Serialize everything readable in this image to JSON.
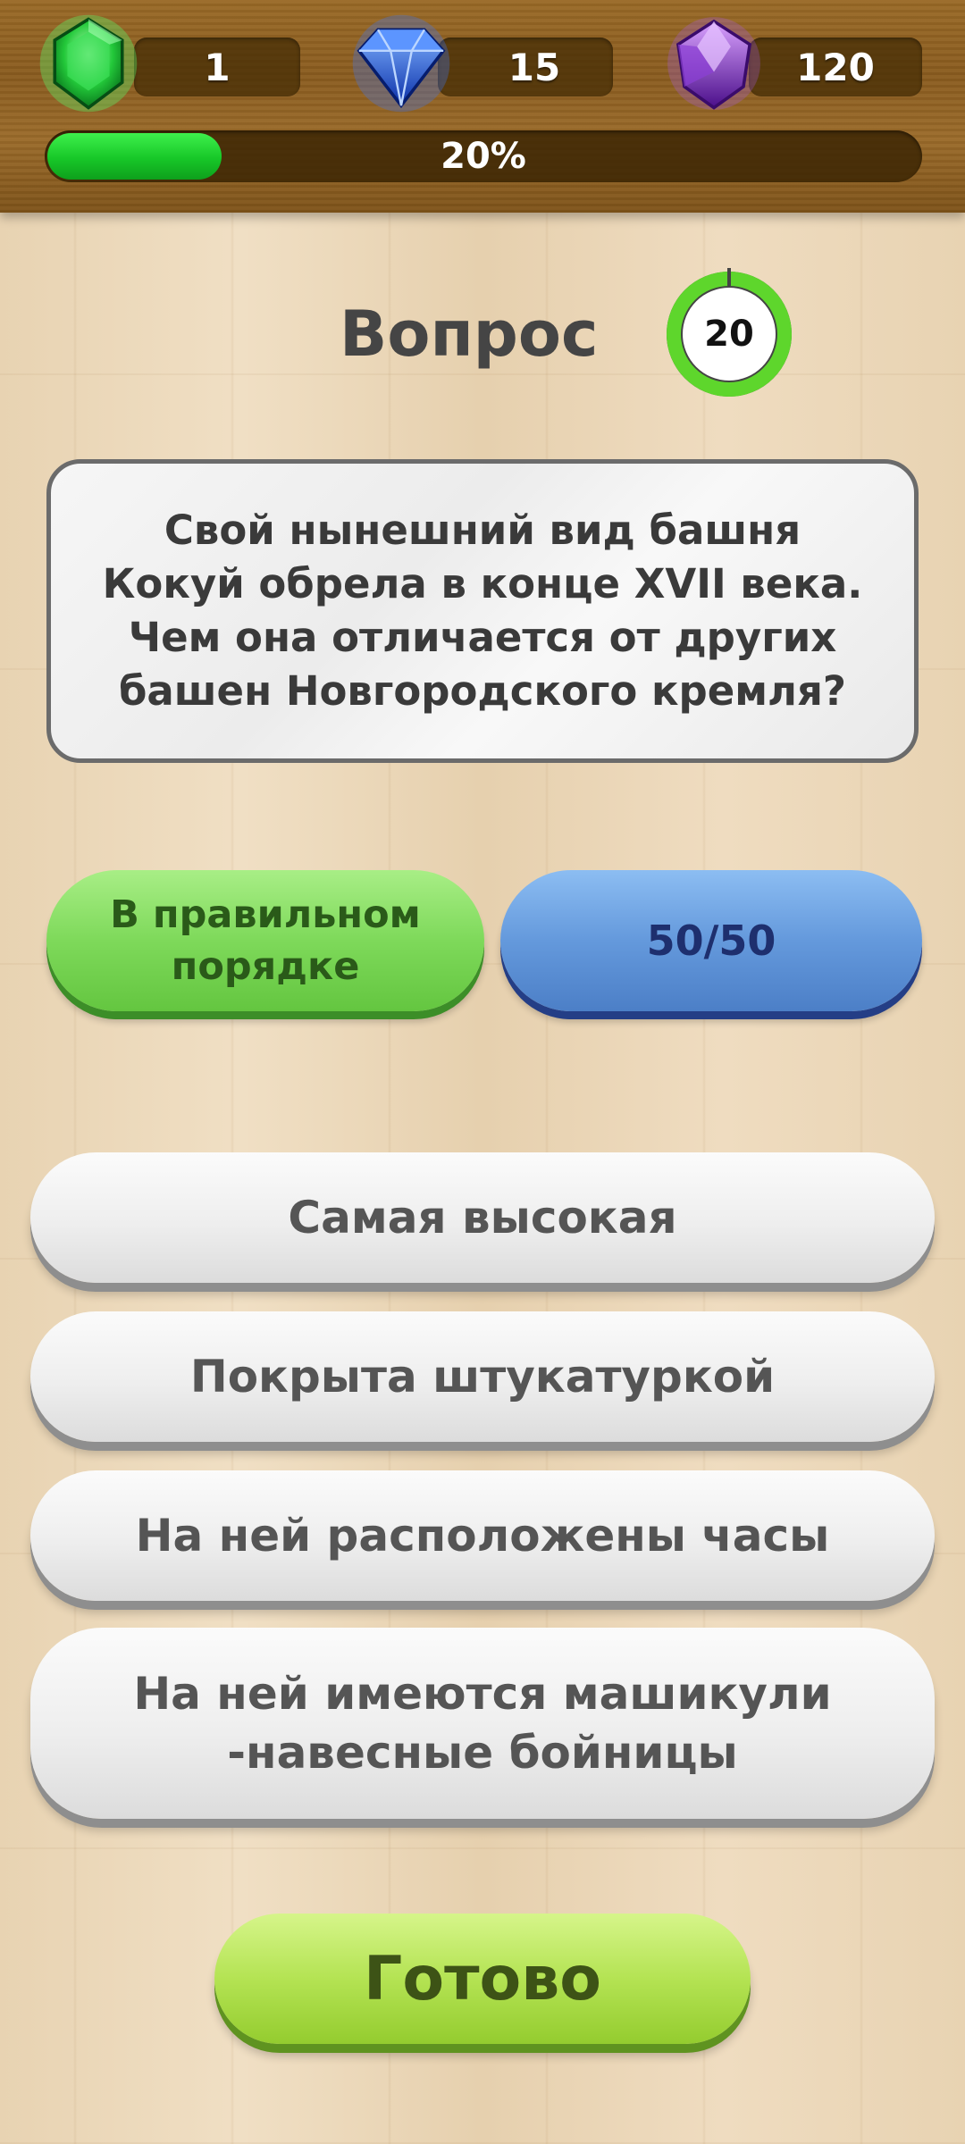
{
  "header": {
    "currencies": [
      {
        "icon": "green-gem-icon",
        "value": "1",
        "color": "#1fbf3a"
      },
      {
        "icon": "blue-gem-icon",
        "value": "15",
        "color": "#1f5ee6"
      },
      {
        "icon": "purple-gem-icon",
        "value": "120",
        "color": "#8a2fd8"
      }
    ],
    "progress": {
      "label": "20%",
      "fraction": 0.2
    }
  },
  "question": {
    "title": "Вопрос",
    "timer": "20",
    "text": "Свой нынешний вид башня Кокуй обрела в конце XVII века. Чем она отличается от других башен Новгородского кремля?"
  },
  "hints": {
    "order_label": "В правильном порядке",
    "fifty_label": "50/50"
  },
  "answers": [
    "Самая высокая",
    "Покрыта штукатуркой",
    "На ней расположены часы",
    "На ней имеются машикули -навесные бойницы"
  ],
  "done_label": "Готово",
  "colors": {
    "accent_green": "#7ed95a",
    "accent_blue": "#6499dc",
    "timer_ring": "#5ed62c"
  }
}
